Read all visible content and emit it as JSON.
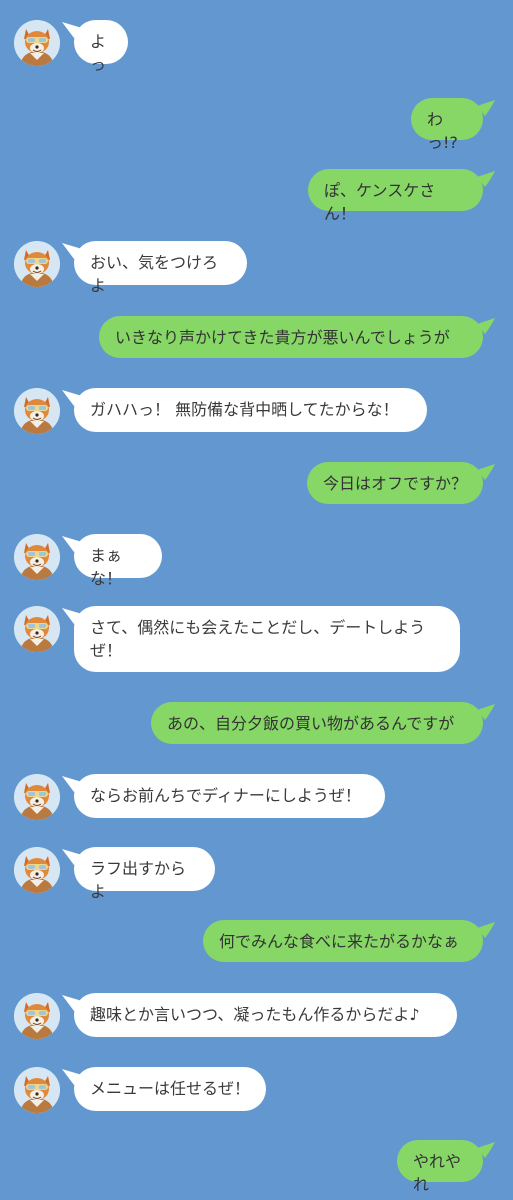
{
  "chat": {
    "messages": [
      {
        "side": "in",
        "text": "よっ"
      },
      {
        "side": "out",
        "text": "わっ!?"
      },
      {
        "side": "out",
        "text": "ぽ、ケンスケさん！"
      },
      {
        "side": "in",
        "text": "おい、気をつけろよ"
      },
      {
        "side": "out",
        "text": "いきなり声かけてきた貴方が悪いんでしょうが"
      },
      {
        "side": "in",
        "text": "ガハハっ！ 無防備な背中晒してたからな！"
      },
      {
        "side": "out",
        "text": "今日はオフですか？"
      },
      {
        "side": "in",
        "text": "まぁな！"
      },
      {
        "side": "in",
        "text": "さて、偶然にも会えたことだし、デートしようぜ！"
      },
      {
        "side": "out",
        "text": "あの、自分夕飯の買い物があるんですが"
      },
      {
        "side": "in",
        "text": "ならお前んちでディナーにしようぜ！"
      },
      {
        "side": "in",
        "text": "ラフ出すからよ"
      },
      {
        "side": "out",
        "text": "何でみんな食べに来たがるかなぁ"
      },
      {
        "side": "in",
        "text": "趣味とか言いつつ、凝ったもん作るからだよ♪"
      },
      {
        "side": "in",
        "text": "メニューは任せるぜ！"
      },
      {
        "side": "out",
        "text": "やれやれ"
      }
    ]
  },
  "colors": {
    "background": "#6298cf",
    "incoming_bubble": "#ffffff",
    "outgoing_bubble": "#86d766"
  },
  "icons": {
    "avatar": "fox-character-avatar-icon"
  }
}
